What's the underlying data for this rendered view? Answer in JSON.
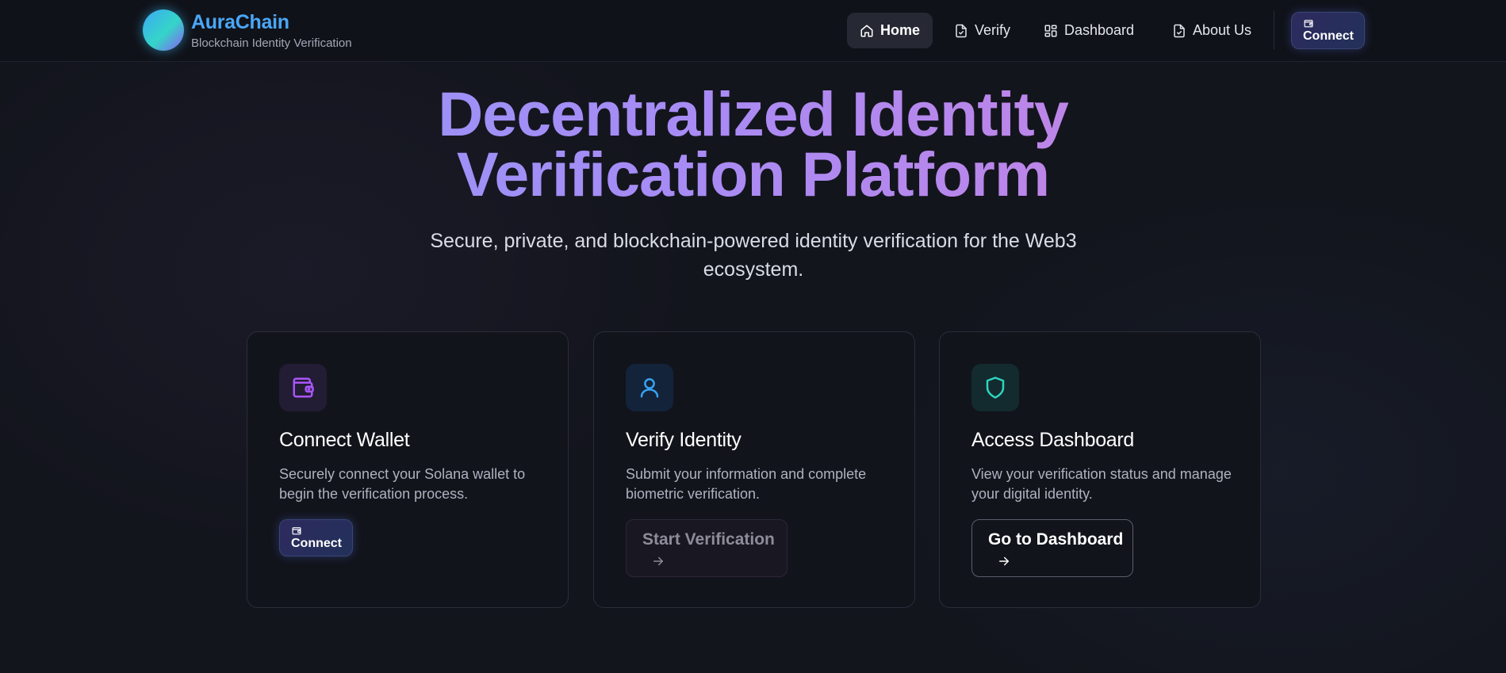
{
  "brand": {
    "name": "AuraChain",
    "tagline": "Blockchain Identity Verification"
  },
  "nav": {
    "items": [
      {
        "label": "Home",
        "icon": "home-icon",
        "active": true
      },
      {
        "label": "Verify",
        "icon": "file-check-icon",
        "active": false
      },
      {
        "label": "Dashboard",
        "icon": "layout-grid-icon",
        "active": false
      },
      {
        "label": "About Us",
        "icon": "file-check-icon",
        "active": false
      }
    ],
    "connect_label": "Connect"
  },
  "hero": {
    "title_line1": "Decentralized Identity",
    "title_line2": "Verification Platform",
    "subtitle": "Secure, private, and blockchain-powered identity verification for the Web3 ecosystem."
  },
  "cards": [
    {
      "icon": "wallet-icon",
      "title": "Connect Wallet",
      "description": "Securely connect your Solana wallet to begin the verification process.",
      "button_label": "Connect"
    },
    {
      "icon": "user-icon",
      "title": "Verify Identity",
      "description": "Submit your information and complete biometric verification.",
      "button_label": "Start Verification",
      "button_disabled": true
    },
    {
      "icon": "shield-icon",
      "title": "Access Dashboard",
      "description": "View your verification status and manage your digital identity.",
      "button_label": "Go to Dashboard"
    }
  ],
  "colors": {
    "brand_blue": "#4aa7f7",
    "wallet_purple": "#a855f7",
    "user_blue": "#38a3f0",
    "shield_teal": "#2dd4bf"
  }
}
